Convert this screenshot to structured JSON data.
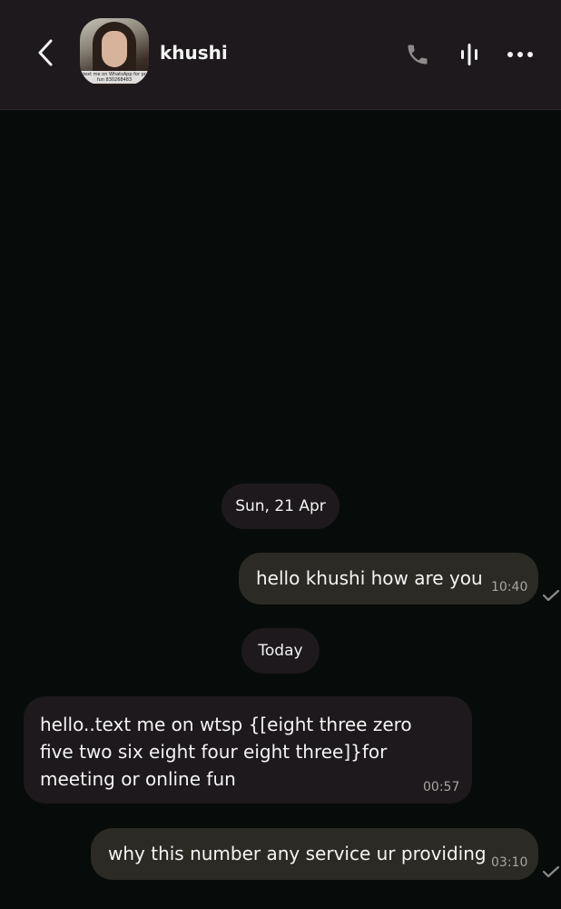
{
  "header": {
    "contact_name": "khushi",
    "avatar_caption": "text me on WhatsApp for pr fun 830268483",
    "icons": [
      "back-icon",
      "phone-icon",
      "voice-wave-icon",
      "more-icon"
    ]
  },
  "conversation": {
    "date_separators": [
      "Sun, 21 Apr",
      "Today"
    ],
    "messages": [
      {
        "direction": "outgoing",
        "text": "hello khushi how are you",
        "time": "10:40",
        "status": "sent"
      },
      {
        "direction": "incoming",
        "text": "hello..text me on wtsp {[eight three zero five two six eight four eight three]}for meeting or online fun",
        "time": "00:57"
      },
      {
        "direction": "outgoing",
        "text": "why this number any service ur providing",
        "time": "03:10",
        "status": "sent"
      }
    ]
  },
  "colors": {
    "background": "#070c0a",
    "header": "#1d191c",
    "outgoing_bubble": "#2b2a24",
    "incoming_bubble": "#1d191c",
    "timestamp": "#a8a6a0"
  }
}
